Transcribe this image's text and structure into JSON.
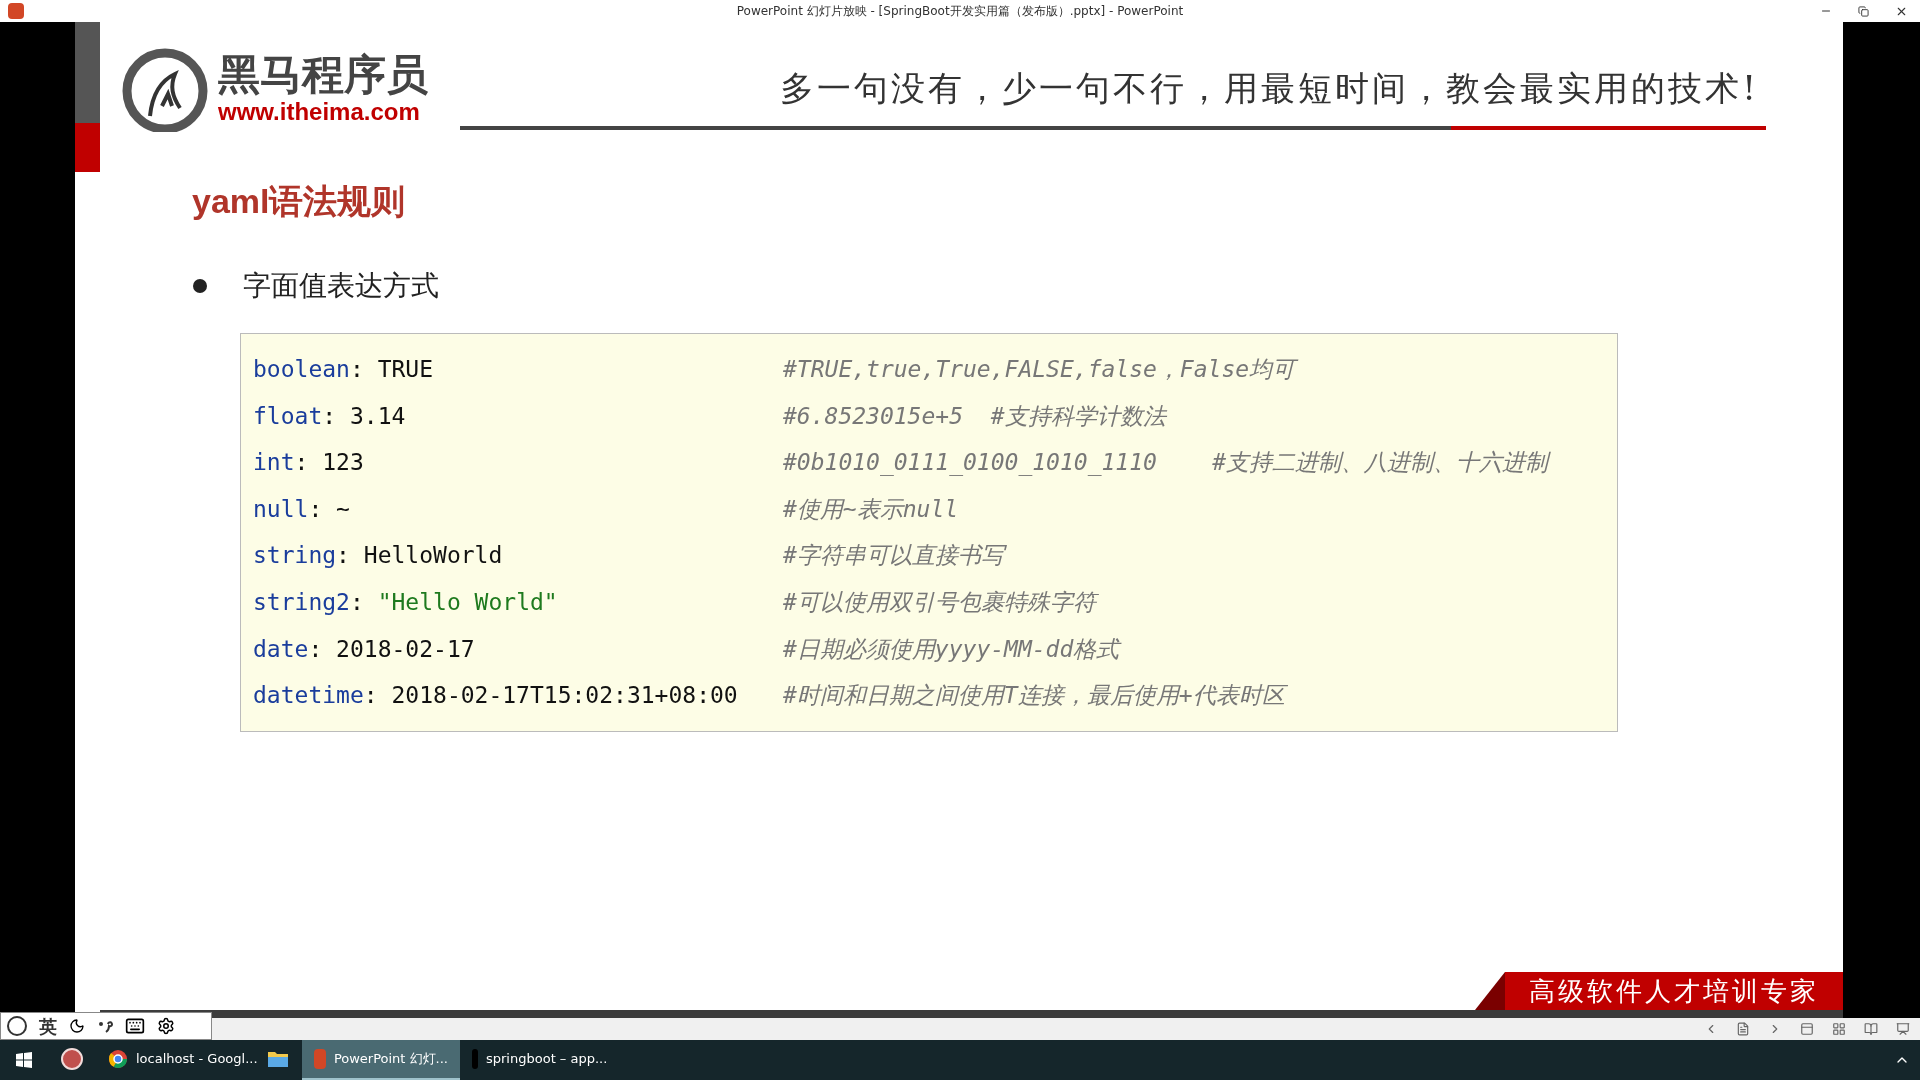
{
  "window": {
    "title": "PowerPoint 幻灯片放映 - [SpringBoot开发实用篇（发布版）.pptx] - PowerPoint"
  },
  "slide": {
    "logo": {
      "name": "黑马程序员",
      "url": "www.itheima.com"
    },
    "slogan": "多一句没有，少一句不行，用最短时间，教会最实用的技术!",
    "heading": "yaml语法规则",
    "bullet": "字面值表达方式",
    "code_lines": [
      {
        "key": "boolean",
        "punct": ":",
        "value": "TRUE",
        "kind": "plain",
        "comment": "#TRUE,true,True,FALSE,false，False均可"
      },
      {
        "key": "float",
        "punct": ":",
        "value": "3.14",
        "kind": "plain",
        "comment": "#6.8523015e+5  #支持科学计数法"
      },
      {
        "key": "int",
        "punct": ":",
        "value": "123",
        "kind": "plain",
        "comment": "#0b1010_0111_0100_1010_1110    #支持二进制、八进制、十六进制"
      },
      {
        "key": "null",
        "punct": ":",
        "value": "~",
        "kind": "plain",
        "comment": "#使用~表示null"
      },
      {
        "key": "string",
        "punct": ":",
        "value": "HelloWorld",
        "kind": "plain",
        "comment": "#字符串可以直接书写"
      },
      {
        "key": "string2",
        "punct": ":",
        "value": "\"Hello World\"",
        "kind": "string",
        "comment": "#可以使用双引号包裹特殊字符"
      },
      {
        "key": "date",
        "punct": ":",
        "value": "2018-02-17",
        "kind": "plain",
        "comment": "#日期必须使用yyyy-MM-dd格式"
      },
      {
        "key": "datetime",
        "punct": ":",
        "value": "2018-02-17T15:02:31+08:00",
        "kind": "plain",
        "comment": "#时间和日期之间使用T连接，最后使用+代表时区"
      }
    ],
    "footer_banner": "高级软件人才培训专家"
  },
  "ime_toolbar": {
    "mode": "英"
  },
  "taskbar": {
    "apps": [
      {
        "kind": "grid-app",
        "selected": false
      },
      {
        "kind": "browser",
        "label": "localhost - Googl...",
        "selected": false
      },
      {
        "kind": "folder",
        "selected": false
      },
      {
        "kind": "slides",
        "label": "PowerPoint 幻灯...",
        "selected": true
      },
      {
        "kind": "ide",
        "label": "springboot – app...",
        "selected": false
      }
    ]
  }
}
